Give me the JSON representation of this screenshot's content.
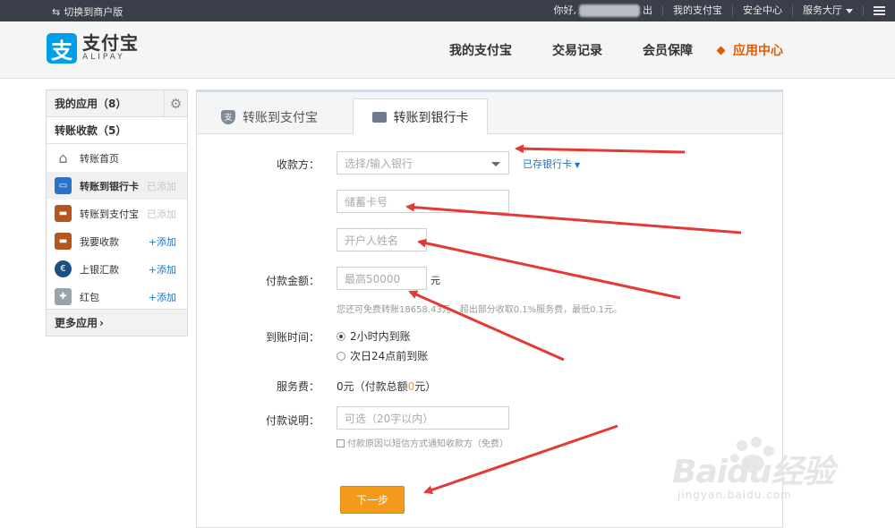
{
  "topbar": {
    "switch_label": "切换到商户版",
    "greeting": "你好,",
    "greeting_suffix": "出",
    "links": [
      "我的支付宝",
      "安全中心"
    ],
    "service_hall": "服务大厅"
  },
  "header": {
    "logo_cn": "支付宝",
    "logo_en": "ALIPAY",
    "logo_mark": "支",
    "nav": [
      "我的支付宝",
      "交易记录",
      "会员保障",
      "应用中心"
    ],
    "active_nav": "应用中心",
    "accent_color": "#e45a00"
  },
  "sidebar": {
    "my_apps": "我的应用（8）",
    "group": "转账收款（5）",
    "items": [
      {
        "label": "转账首页",
        "status": "",
        "icon": "home-icon"
      },
      {
        "label": "转账到银行卡",
        "status": "已添加",
        "icon": "bank-card-icon"
      },
      {
        "label": "转账到支付宝",
        "status": "已添加",
        "icon": "wallet-icon"
      },
      {
        "label": "我要收款",
        "status": "+添加",
        "icon": "receive-icon"
      },
      {
        "label": "上银汇款",
        "status": "+添加",
        "icon": "remit-icon"
      },
      {
        "label": "红包",
        "status": "+添加",
        "icon": "puzzle-icon"
      }
    ],
    "more": "更多应用"
  },
  "tabs": {
    "alipay": "转账到支付宝",
    "bank": "转账到银行卡",
    "alipay_icon_text": "支"
  },
  "form": {
    "payee_label": "收款方：",
    "bank_placeholder": "选择/输入银行",
    "saved_cards": "已存银行卡",
    "card_placeholder": "储蓄卡号",
    "name_placeholder": "开户人姓名",
    "amount_label": "付款金额：",
    "amount_placeholder": "最高50000",
    "unit": "元",
    "amount_hint": "您还可免费转账18658.43元，超出部分收取0.1%服务费，最低0.1元。",
    "arrival_label": "到账时间：",
    "arrival_options": [
      "2小时内到账",
      "次日24点前到账"
    ],
    "fee_label": "服务费：",
    "fee_value_prefix": "0元（付款总额",
    "fee_total": "0",
    "fee_value_suffix": "元）",
    "note_label": "付款说明：",
    "note_placeholder": "可选（20字以内）",
    "sms_label": "付款原因以短信方式通知收款方（免费）",
    "next_button": "下一步"
  },
  "watermark": {
    "brand": "Baidu经验",
    "url": "jingyan.baidu.com"
  }
}
